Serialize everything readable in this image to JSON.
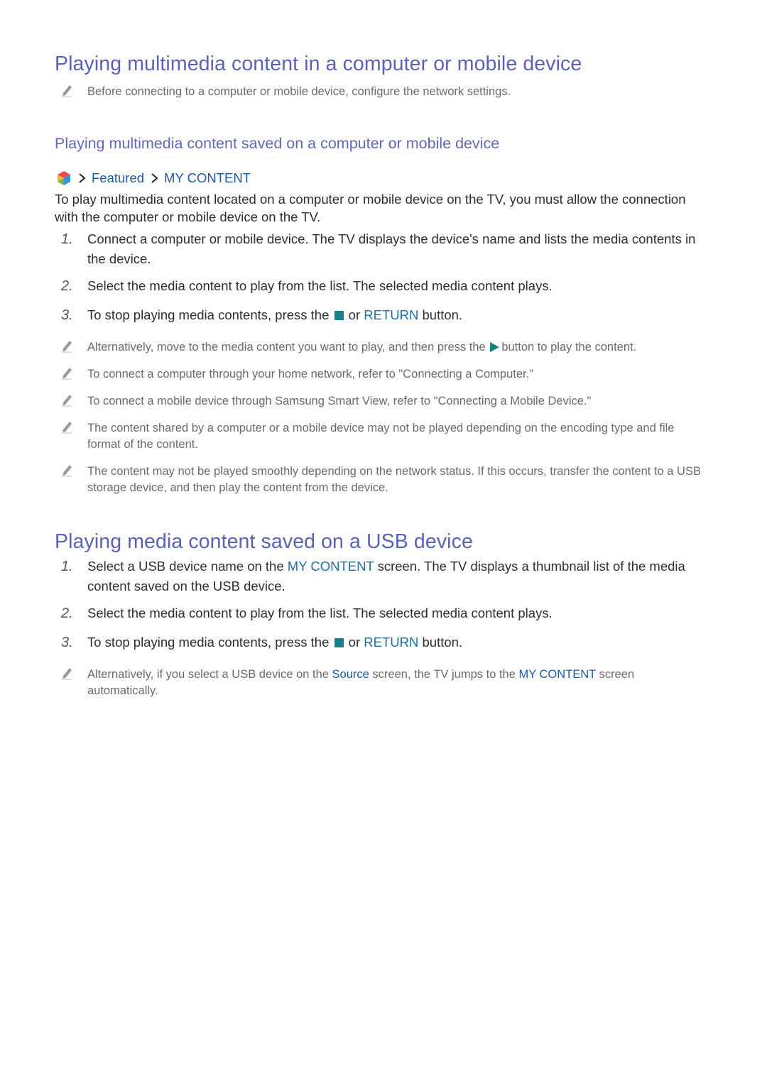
{
  "section1": {
    "title": "Playing multimedia content in a computer or mobile device",
    "note": "Before connecting to a computer or mobile device, configure the network settings."
  },
  "section2": {
    "title": "Playing multimedia content saved on a computer or mobile device",
    "breadcrumb": {
      "home_icon": "smart-hub-cube-icon",
      "items": [
        "Featured",
        "MY CONTENT"
      ]
    },
    "intro": "To play multimedia content located on a computer or mobile device on the TV, you must allow the connection with the computer or mobile device on the TV.",
    "steps": [
      {
        "num": "1.",
        "text": "Connect a computer or mobile device. The TV displays the device's name and lists the media contents in the device."
      },
      {
        "num": "2.",
        "text": "Select the media content to play from the list. The selected media content plays."
      },
      {
        "num": "3.",
        "text_before": "To stop playing media contents, press the",
        "icon": "stop-icon",
        "text_mid": "or",
        "keyword": "RETURN",
        "text_after": "button."
      }
    ],
    "notes": [
      {
        "text_before": "Alternatively, move to the media content you want to play, and then press the",
        "icon": "play-icon",
        "text_after": "button to play the content."
      },
      {
        "text": "To connect a computer through your home network, refer to \"Connecting a Computer.\""
      },
      {
        "text": "To connect a mobile device through Samsung Smart View, refer to \"Connecting a Mobile Device.\""
      },
      {
        "text": "The content shared by a computer or a mobile device may not be played depending on the encoding type and file format of the content."
      },
      {
        "text": "The content may not be played smoothly depending on the network status. If this occurs, transfer the content to a USB storage device, and then play the content from the device."
      }
    ]
  },
  "section3": {
    "title": "Playing media content saved on a USB device",
    "steps": [
      {
        "num": "1.",
        "text_before": "Select a USB device name on the",
        "keyword": "MY CONTENT",
        "text_after": "screen. The TV displays a thumbnail list of the media content saved on the USB device."
      },
      {
        "num": "2.",
        "text": "Select the media content to play from the list. The selected media content plays."
      },
      {
        "num": "3.",
        "text_before": "To stop playing media contents, press the",
        "icon": "stop-icon",
        "text_mid": "or",
        "keyword": "RETURN",
        "text_after": "button."
      }
    ],
    "note": {
      "text_before": "Alternatively, if you select a USB device on the",
      "keyword1": "Source",
      "text_mid": "screen, the TV jumps to the",
      "keyword2": "MY CONTENT",
      "text_after": "screen automatically."
    }
  },
  "colors": {
    "heading": "#5a62b8",
    "keyword": "#1e6fa8",
    "control_icon": "#1b7f88",
    "note_text": "#6a6a6a"
  }
}
